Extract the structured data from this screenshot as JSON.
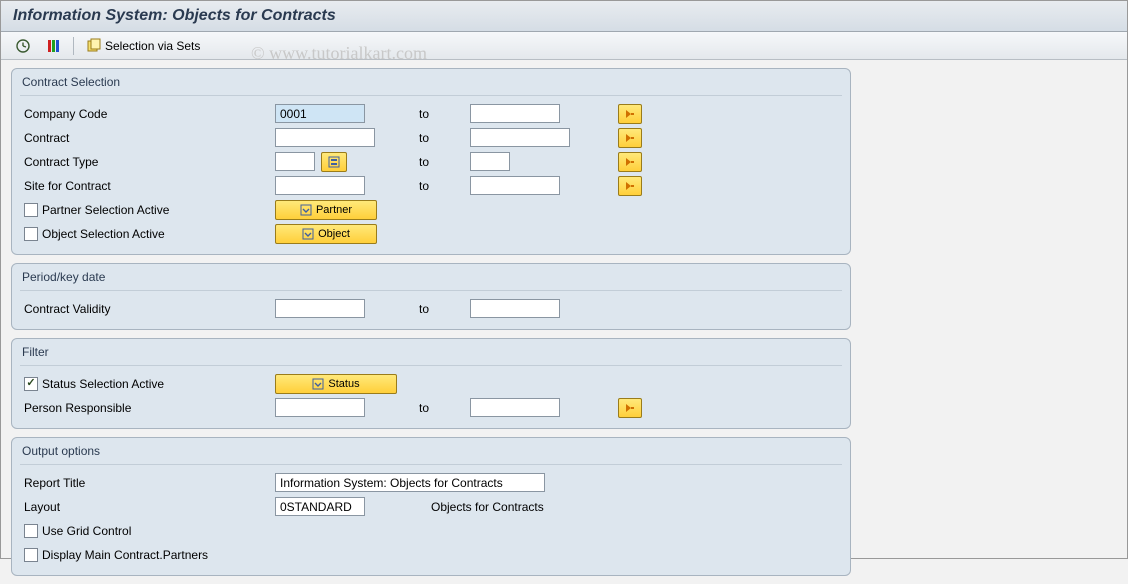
{
  "window_title": "Information System: Objects for Contracts",
  "toolbar": {
    "selection_via_sets": "Selection via Sets"
  },
  "watermark": "© www.tutorialkart.com",
  "to_label": "to",
  "groups": {
    "contract_selection": {
      "title": "Contract Selection",
      "company_code": {
        "label": "Company Code",
        "from": "0001",
        "to": ""
      },
      "contract": {
        "label": "Contract",
        "from": "",
        "to": ""
      },
      "contract_type": {
        "label": "Contract Type",
        "from": "",
        "to": ""
      },
      "site": {
        "label": "Site for Contract",
        "from": "",
        "to": ""
      },
      "partner_sel": {
        "label": "Partner Selection Active",
        "checked": false,
        "button": "Partner"
      },
      "object_sel": {
        "label": "Object Selection Active",
        "checked": false,
        "button": "Object"
      }
    },
    "period": {
      "title": "Period/key date",
      "validity": {
        "label": "Contract Validity",
        "from": "",
        "to": ""
      }
    },
    "filter": {
      "title": "Filter",
      "status_sel": {
        "label": "Status Selection Active",
        "checked": true,
        "button": "Status"
      },
      "person": {
        "label": "Person Responsible",
        "from": "",
        "to": ""
      }
    },
    "output": {
      "title": "Output options",
      "report_title": {
        "label": "Report Title",
        "value": "Information System: Objects for Contracts"
      },
      "layout": {
        "label": "Layout",
        "value": "0STANDARD",
        "desc": "Objects for Contracts"
      },
      "grid": {
        "label": "Use Grid Control",
        "checked": false
      },
      "main_partners": {
        "label": "Display Main Contract.Partners",
        "checked": false
      }
    }
  }
}
